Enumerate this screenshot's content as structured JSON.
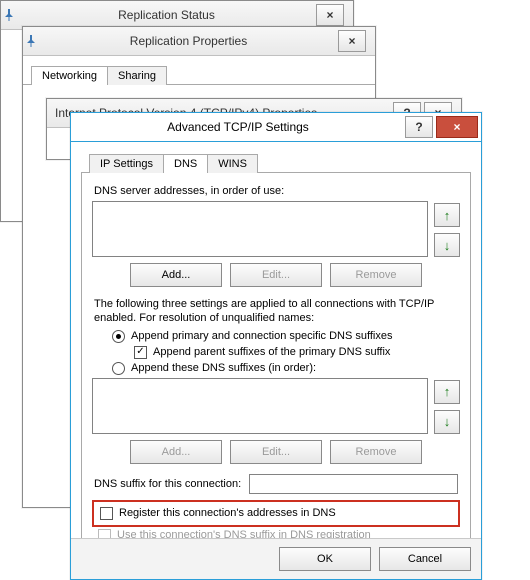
{
  "bg1": {
    "title": "Replication Status",
    "close": "×"
  },
  "bg2": {
    "title": "Replication Properties",
    "close": "×",
    "tabs": {
      "networking": "Networking",
      "sharing": "Sharing"
    }
  },
  "bg3": {
    "title": "Internet Protocol Version 4 (TCP/IPv4) Properties",
    "help": "?",
    "close": "×"
  },
  "adv": {
    "title": "Advanced TCP/IP Settings",
    "help": "?",
    "close": "×",
    "tabs": {
      "ip": "IP Settings",
      "dns": "DNS",
      "wins": "WINS"
    },
    "dns_servers_label": "DNS server addresses, in order of use:",
    "btn_add": "Add...",
    "btn_edit": "Edit...",
    "btn_remove": "Remove",
    "para1": "The following three settings are applied to all connections with TCP/IP enabled. For resolution of unqualified names:",
    "radio_primary": "Append primary and connection specific DNS suffixes",
    "check_parent": "Append parent suffixes of the primary DNS suffix",
    "radio_these": "Append these DNS suffixes (in order):",
    "suffix_label": "DNS suffix for this connection:",
    "check_register": "Register this connection's addresses in DNS",
    "check_use_suffix": "Use this connection's DNS suffix in DNS registration",
    "ok": "OK",
    "cancel": "Cancel",
    "arrow_up": "↑",
    "arrow_down": "↓"
  }
}
